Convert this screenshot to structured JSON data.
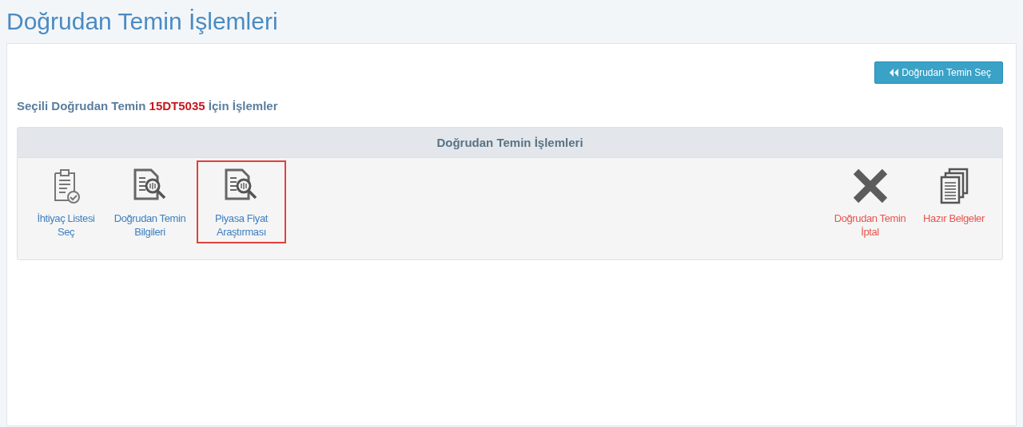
{
  "page_title": "Doğrudan Temin İşlemleri",
  "back_button": {
    "label": "Doğrudan Temin Seç"
  },
  "heading": "Seçili Doğrudan Temin **15DT5035** İçin İşlemler",
  "panel": {
    "title": "Doğrudan Temin İşlemleri",
    "left_actions": [
      {
        "kind": "checklist",
        "label_lines": [
          "İhtiyaç Listesi",
          "Seç"
        ],
        "color": "#3d7fc0",
        "selected": false
      },
      {
        "kind": "search-doc",
        "label_lines": [
          "Doğrudan Temin",
          "Bilgileri"
        ],
        "color": "#3d7fc0",
        "selected": false
      },
      {
        "kind": "search-doc",
        "label_lines": [
          "Piyasa Fiyat",
          "Araştırması"
        ],
        "color": "#3d7fc0",
        "selected": true
      }
    ],
    "right_actions": [
      {
        "kind": "cross",
        "label_lines": [
          "Doğrudan Temin",
          "İptal"
        ],
        "color": "#e8554e",
        "selected": false
      },
      {
        "kind": "documents",
        "label_lines": [
          "Hazır Belgeler"
        ],
        "color": "#e8554e",
        "selected": false
      }
    ]
  }
}
